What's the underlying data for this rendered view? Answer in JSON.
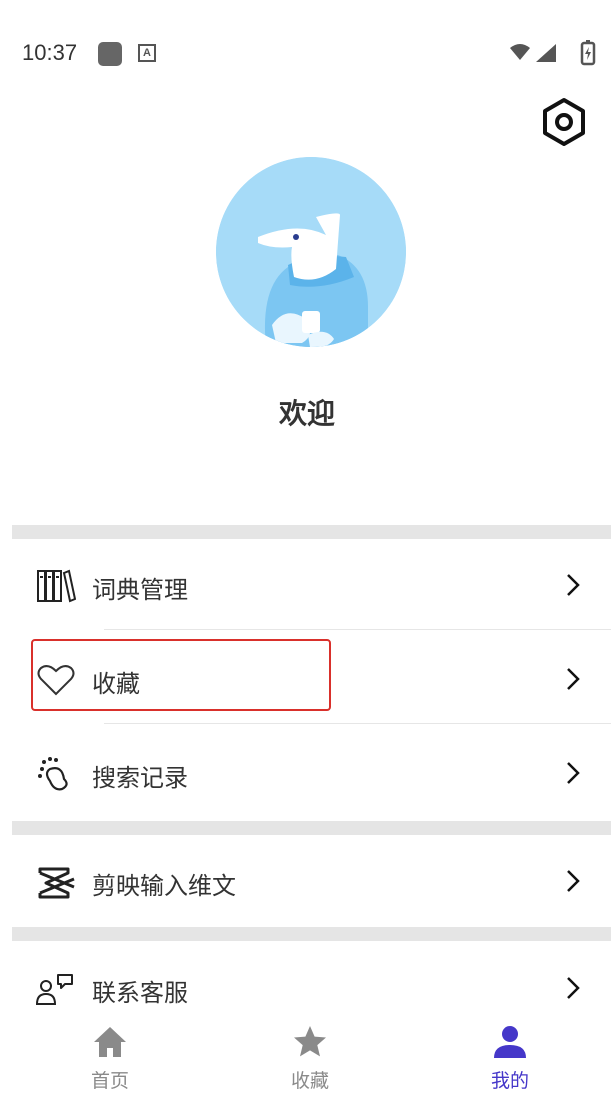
{
  "status_bar": {
    "time": "10:37",
    "notif_letter": "A"
  },
  "profile": {
    "welcome": "欢迎"
  },
  "menu": {
    "dictionary": "词典管理",
    "favorites": "收藏",
    "history": "搜索记录",
    "capcut": "剪映输入维文",
    "support": "联系客服"
  },
  "nav": {
    "home": "首页",
    "favorites": "收藏",
    "mine": "我的",
    "active": "mine",
    "active_color": "#4537c9",
    "inactive_color": "#8a8a8a"
  },
  "colors": {
    "highlight": "#d9302b",
    "avatar_bg": "#a6dbf8"
  },
  "icons": {
    "settings": "hexagon-settings-icon",
    "dictionary": "books-icon",
    "favorites": "heart-outline-icon",
    "history": "footprint-icon",
    "capcut": "capcut-logo-icon",
    "support": "customer-service-icon",
    "chevron": "chevron-right-icon",
    "nav_home": "home-icon",
    "nav_favorites": "star-icon",
    "nav_mine": "person-icon"
  }
}
